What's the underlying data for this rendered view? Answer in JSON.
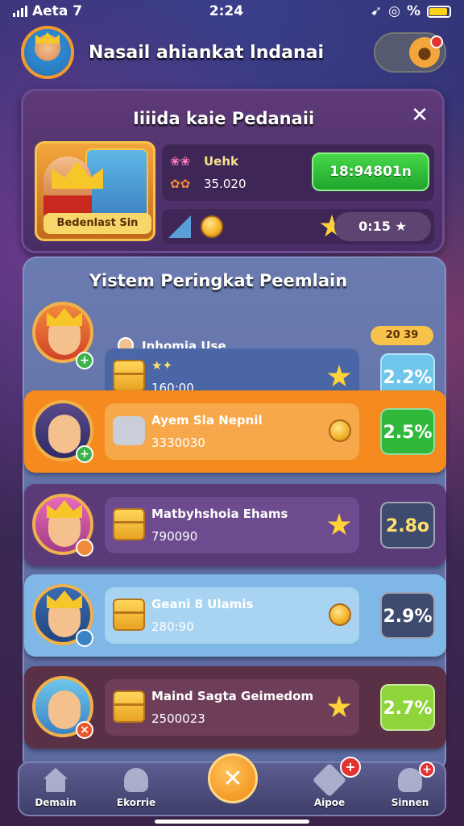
{
  "status": {
    "carrier": "Aeta 7",
    "time": "2:24",
    "battery_label": "%"
  },
  "header": {
    "title": "Nasail ahiankat lndanai"
  },
  "promo": {
    "title": "Iiiida kaie Pedanaii",
    "hero_label": "Bedenlast Sin",
    "player_name": "Uehk",
    "player_score": "35.020",
    "green_button": "18:94801n",
    "timer": "0:15"
  },
  "ranking": {
    "title": "Yistem Peringkat Peemlain",
    "badge": "20 39",
    "rows": [
      {
        "name": "Inhomia Use",
        "score": "160:00",
        "pct": "2.2%"
      },
      {
        "name": "Ayem Sla Nepnil",
        "score": "3330030",
        "pct": "2.5%"
      },
      {
        "name": "Matbyhshoia Ehams",
        "score": "790090",
        "pct": "2.8o"
      },
      {
        "name": "Geani 8 Ulamis",
        "score": "280:90",
        "pct": "2.9%"
      },
      {
        "name": "Maind Sagta Geimedom",
        "score": "2500023",
        "pct": "2.7%"
      }
    ]
  },
  "nav": {
    "items": [
      {
        "label": "Demain"
      },
      {
        "label": "Ekorrie"
      },
      {
        "label": "Aipoe"
      },
      {
        "label": "Sinnen"
      }
    ]
  },
  "colors": {
    "row_orange": "#f58a1e",
    "row_purple": "#5b3a78",
    "row_blue": "#7fb8e6",
    "row_maroon": "#5a3046",
    "green": "#2fb83a"
  }
}
